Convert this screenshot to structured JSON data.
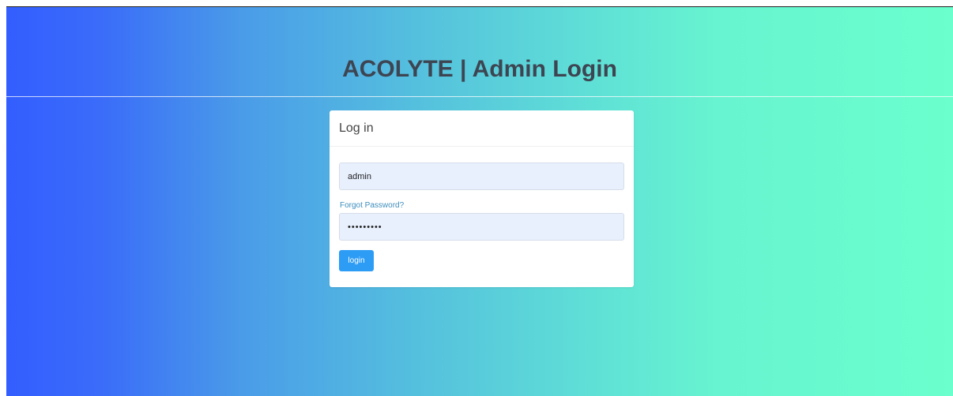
{
  "header": {
    "title": "ACOLYTE | Admin Login"
  },
  "login_panel": {
    "heading": "Log in",
    "username_value": "admin",
    "password_value": "•••••••••",
    "forgot_link": "Forgot Password?",
    "submit_label": "login"
  },
  "colors": {
    "gradient_start": "#335eff",
    "gradient_end": "#6affcd",
    "button": "#2d9cf5",
    "link": "#3c8dbc",
    "input_bg": "#e8f0fe"
  }
}
